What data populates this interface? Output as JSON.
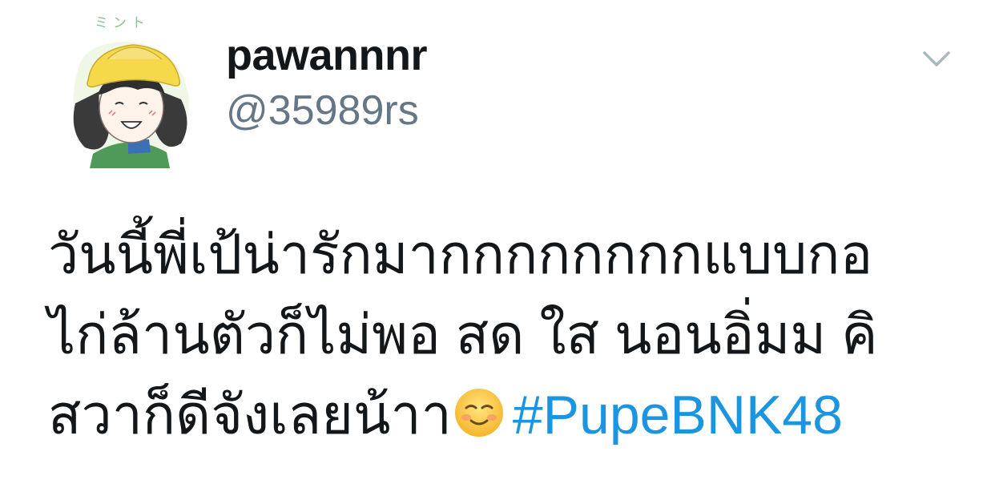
{
  "tweet": {
    "avatar": {
      "icon": "cartoon-girl-avatar",
      "caption": "ミント"
    },
    "display_name": "pawannnr",
    "handle": "@35989rs",
    "menu_icon": "chevron-down-icon",
    "text_lines": [
      "วันนี้พี่เป้น่ารักมากกกกกกกกแบบกอ",
      "ไก่ล้านตัวก็ไม่พอ สด ใส นอนอิ่มม คิ",
      "สวาก็ดีจังเลยน้าา"
    ],
    "emoji": "smiling-face-emoji",
    "hashtag": "#PupeBNK48",
    "colors": {
      "text": "#14171a",
      "secondary": "#657786",
      "link": "#1b95e0",
      "chevron": "#aab8c2"
    }
  }
}
